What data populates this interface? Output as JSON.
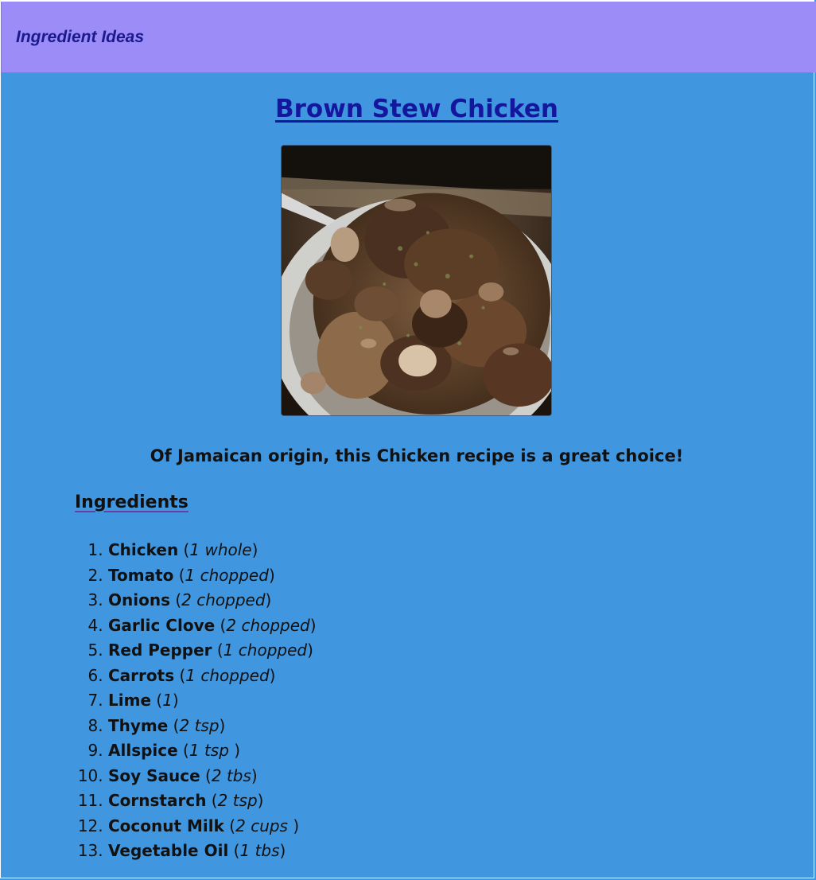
{
  "header": {
    "brand": "Ingredient Ideas",
    "background": "#9b8cf8"
  },
  "recipe": {
    "title": "Brown Stew Chicken",
    "image_alt": "Brown Stew Chicken",
    "tagline": "Of Jamaican origin, this Chicken recipe is a great choice!",
    "ingredients_heading": "Ingredients",
    "ingredients": [
      {
        "name": "Chicken",
        "qty": "1 whole"
      },
      {
        "name": "Tomato",
        "qty": "1 chopped"
      },
      {
        "name": "Onions",
        "qty": "2 chopped"
      },
      {
        "name": "Garlic Clove",
        "qty": "2 chopped"
      },
      {
        "name": "Red Pepper",
        "qty": "1 chopped"
      },
      {
        "name": "Carrots",
        "qty": "1 chopped"
      },
      {
        "name": "Lime",
        "qty": "1"
      },
      {
        "name": "Thyme",
        "qty": "2 tsp"
      },
      {
        "name": "Allspice",
        "qty": "1 tsp "
      },
      {
        "name": "Soy Sauce",
        "qty": "2 tbs"
      },
      {
        "name": "Cornstarch",
        "qty": "2 tsp"
      },
      {
        "name": "Coconut Milk",
        "qty": "2 cups "
      },
      {
        "name": "Vegetable Oil",
        "qty": "1 tbs"
      }
    ]
  },
  "colors": {
    "page_background": "#4097e0",
    "title_link": "#15169e",
    "brand_text": "#1a1a8c"
  }
}
